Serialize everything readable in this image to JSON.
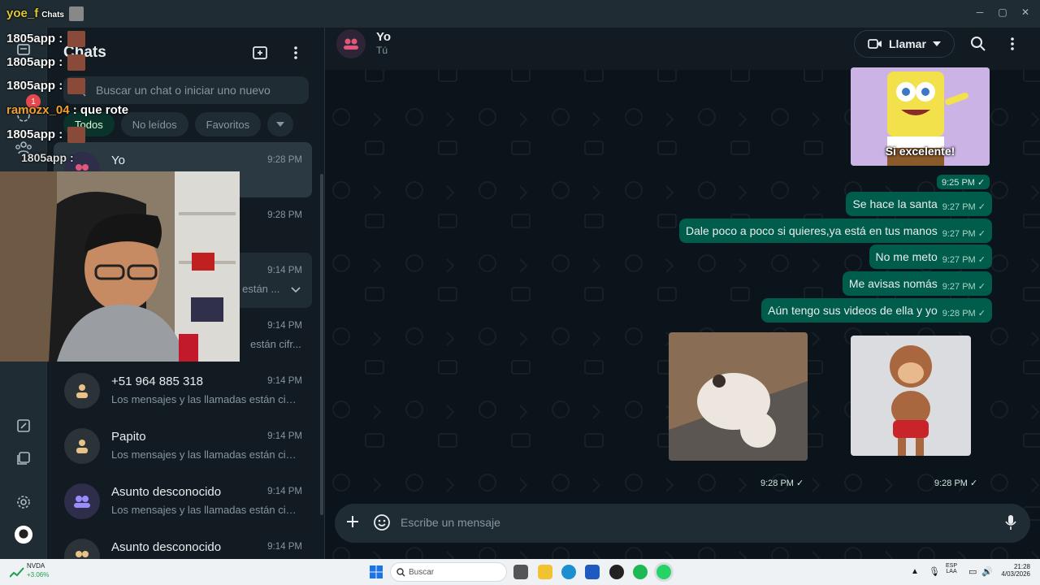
{
  "window": {
    "minimize": "─",
    "maximize": "▢",
    "close": "✕"
  },
  "rail": {
    "badge": "1"
  },
  "sidebar": {
    "title": "Chats",
    "search_placeholder": "Buscar un chat o iniciar uno nuevo",
    "filters": [
      "Todos",
      "No leídos",
      "Favoritos"
    ],
    "chats": [
      {
        "name": "Yo",
        "time": "9:28 PM",
        "subtitle": "",
        "type": "group"
      },
      {
        "name": "",
        "time": "9:28 PM",
        "subtitle": "",
        "type": "person"
      },
      {
        "name": "",
        "time": "9:14 PM",
        "subtitle": "s están ...",
        "type": "person"
      },
      {
        "name": "",
        "time": "9:14 PM",
        "subtitle": "están cifr...",
        "type": "person"
      },
      {
        "name": "+51 964 885 318",
        "time": "9:14 PM",
        "subtitle": "Los mensajes y las llamadas están cifr...",
        "type": "person"
      },
      {
        "name": "Papito",
        "time": "9:14 PM",
        "subtitle": "Los mensajes y las llamadas están cifr...",
        "type": "person"
      },
      {
        "name": "Asunto desconocido",
        "time": "9:14 PM",
        "subtitle": "Los mensajes y las llamadas están cifr...",
        "type": "group"
      },
      {
        "name": "Asunto desconocido",
        "time": "9:14 PM",
        "subtitle": "",
        "type": "group"
      }
    ]
  },
  "chat": {
    "name": "Yo",
    "subtitle": "Tú",
    "call_label": "Llamar",
    "sticker_caption": "Si excelente!",
    "sticker_time": "9:25 PM ✓",
    "messages": [
      {
        "text": "Se hace la santa",
        "time": "9:27 PM ✓"
      },
      {
        "text": "Dale poco a poco si quieres,ya está en tus manos",
        "time": "9:27 PM ✓"
      },
      {
        "text": "No me meto",
        "time": "9:27 PM ✓"
      },
      {
        "text": "Me avisas nomás",
        "time": "9:27 PM ✓"
      },
      {
        "text": "Aún tengo sus videos de ella y yo",
        "time": "9:28 PM ✓"
      }
    ],
    "gif_time_1": "9:28 PM ✓",
    "gif_time_2": "9:28 PM ✓",
    "composer_placeholder": "Escribe un mensaje"
  },
  "overlay": {
    "top_user": "yoe_f",
    "top_text": "Chats",
    "lines": [
      {
        "user": "1805app",
        "text": ":"
      },
      {
        "user": "1805app",
        "text": ":"
      },
      {
        "user": "1805app",
        "text": ":"
      },
      {
        "user": "ramozx_04",
        "text": ": que rote"
      },
      {
        "user": "1805app",
        "text": ":"
      },
      {
        "user": "1805app",
        "text": ":"
      }
    ],
    "username_color": "#f0c040"
  },
  "taskbar": {
    "widget_name": "NVDA",
    "widget_change": "+3.06%",
    "search_label": "Buscar",
    "lang_top": "ESP",
    "lang_bottom": "LAA",
    "clock_time": "21:28",
    "clock_date": "4/03/2026"
  },
  "colors": {
    "accent": "#005c4b",
    "bg": "#0b141a",
    "panel": "#111b21"
  }
}
